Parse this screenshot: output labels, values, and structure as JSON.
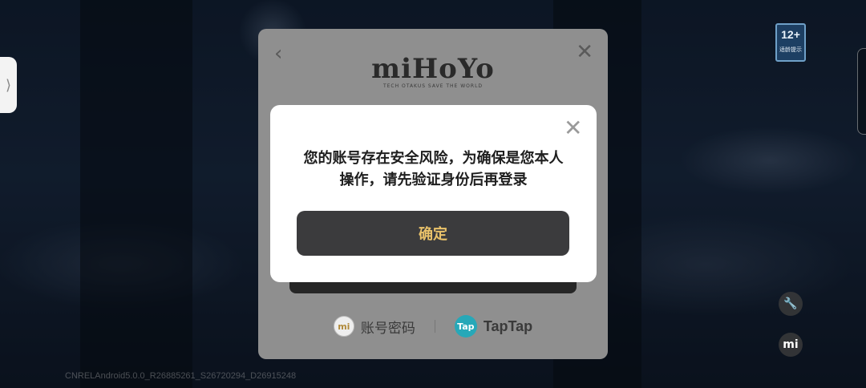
{
  "side_tab": {
    "icon": "chevron-right-icon",
    "glyph": "⟩"
  },
  "age_badge": {
    "rating": "12+",
    "label": "适龄提示"
  },
  "tools": {
    "wrench_icon": "wrench-icon",
    "wrench_glyph": "🔧",
    "mi_label": "mi"
  },
  "version": "CNRELAndroid5.0.0_R26885261_S26720294_D26915248",
  "login": {
    "back_glyph": "‹",
    "close_glyph": "✕",
    "logo_text": "miHoYo",
    "logo_tagline": "TECH OTAKUS SAVE THE WORLD",
    "options": {
      "account_icon_text": "mi",
      "account_label": "账号密码",
      "taptap_icon_text": "Tap",
      "taptap_label": "TapTap"
    }
  },
  "alert": {
    "close_glyph": "✕",
    "message": "您的账号存在安全风险，为确保是您本人操作，请先验证身份后再登录",
    "confirm_label": "确定"
  },
  "colors": {
    "accent_gold": "#e9c26a",
    "button_dark": "#3b3b3d",
    "taptap_teal": "#27a8b8"
  }
}
